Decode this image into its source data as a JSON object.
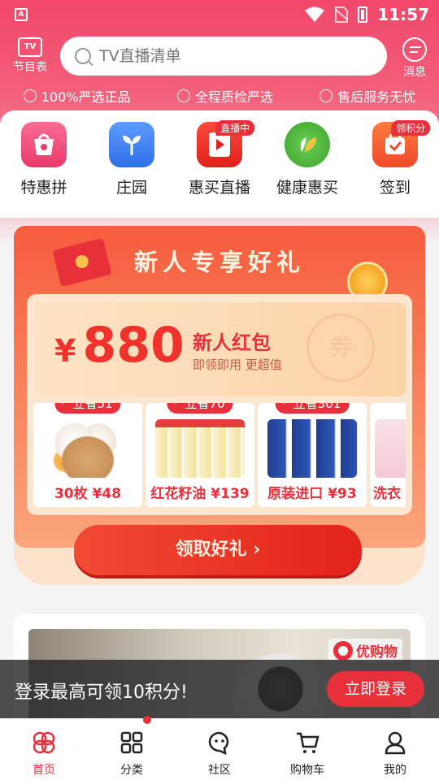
{
  "status_bar": {
    "time": "11:57",
    "app_icon": "A"
  },
  "header": {
    "tv_guide_label": "节目表",
    "tv_icon_text": "TV",
    "search_placeholder": "TV直播清单",
    "message_label": "消息"
  },
  "promises": [
    "100%严选正品",
    "全程质检严选",
    "售后服务无忧"
  ],
  "quick_menu": [
    {
      "label": "特惠拼",
      "icon": "shopping-bag-icon",
      "color": "#f04c7a",
      "badge": ""
    },
    {
      "label": "庄园",
      "icon": "farm-leaf-icon",
      "color": "#3d7ff2",
      "badge": ""
    },
    {
      "label": "惠买直播",
      "icon": "live-play-icon",
      "color": "#e8303a",
      "badge": "直播中"
    },
    {
      "label": "健康惠买",
      "icon": "health-leaf-icon",
      "color": "#4ab53d",
      "badge": ""
    },
    {
      "label": "签到",
      "icon": "calendar-check-icon",
      "color": "#f25a34",
      "badge": "领积分"
    }
  ],
  "gift": {
    "title": "新人专享好礼",
    "currency": "¥",
    "amount": "880",
    "red_packet_title": "新人红包",
    "red_packet_sub": "即领即用  更超值",
    "seal_text": "券",
    "products": [
      {
        "save": "立省51",
        "label": "30枚 ¥48",
        "image": "eggs"
      },
      {
        "save": "立省70",
        "label": "红花籽油 ¥139",
        "image": "oil"
      },
      {
        "save": "立省301",
        "label": "原装进口 ¥93",
        "image": "bottles"
      },
      {
        "save": "",
        "label": "洗衣",
        "image": "wash"
      }
    ],
    "claim_button": "领取好礼  ›"
  },
  "banner": {
    "brand": "优购物"
  },
  "login_bar": {
    "text": "登录最高可领10积分!",
    "button": "立即登录"
  },
  "bottom_nav": [
    {
      "label": "首页",
      "icon": "home-icon",
      "active": true,
      "dot": false
    },
    {
      "label": "分类",
      "icon": "grid-icon",
      "active": false,
      "dot": true
    },
    {
      "label": "社区",
      "icon": "community-icon",
      "active": false,
      "dot": false
    },
    {
      "label": "购物车",
      "icon": "cart-icon",
      "active": false,
      "dot": false
    },
    {
      "label": "我的",
      "icon": "profile-icon",
      "active": false,
      "dot": false
    }
  ],
  "colors": {
    "brand_red": "#e8303a",
    "header_pink": "#f2476a"
  }
}
